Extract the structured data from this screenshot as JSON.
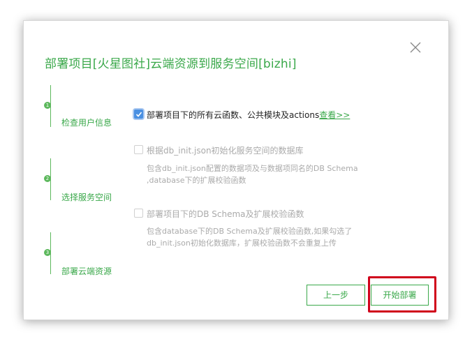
{
  "dialog": {
    "title": "部署项目[火星图社]云端资源到服务空间[bizhi]",
    "close_icon": "close-icon"
  },
  "steps": [
    {
      "number": "1",
      "label": "检查用户信息"
    },
    {
      "number": "2",
      "label": "选择服务空间"
    },
    {
      "number": "3",
      "label": "部署云端资源"
    }
  ],
  "options": {
    "deploy_all": {
      "checked": true,
      "enabled": true,
      "label": "部署项目下的所有云函数、公共模块及actions",
      "link": "查看>>"
    },
    "init_db": {
      "checked": false,
      "enabled": false,
      "label": "根据db_init.json初始化服务空间的数据库",
      "description": [
        "包含db_init.json配置的数据项及与数据项同名的DB Schema",
        ",database下的扩展校验函数"
      ]
    },
    "deploy_schema": {
      "checked": false,
      "enabled": false,
      "label": "部署项目下的DB Schema及扩展校验函数",
      "description": [
        "包含database下的DB Schema及扩展校验函数,如果勾选了",
        "db_init.json初始化数据库，扩展校验函数不会重复上传"
      ]
    }
  },
  "buttons": {
    "prev": "上一步",
    "deploy": "开始部署"
  },
  "colors": {
    "accent": "#3aa84a",
    "highlight": "#d0021b",
    "checkbox": "#4a90e2"
  }
}
